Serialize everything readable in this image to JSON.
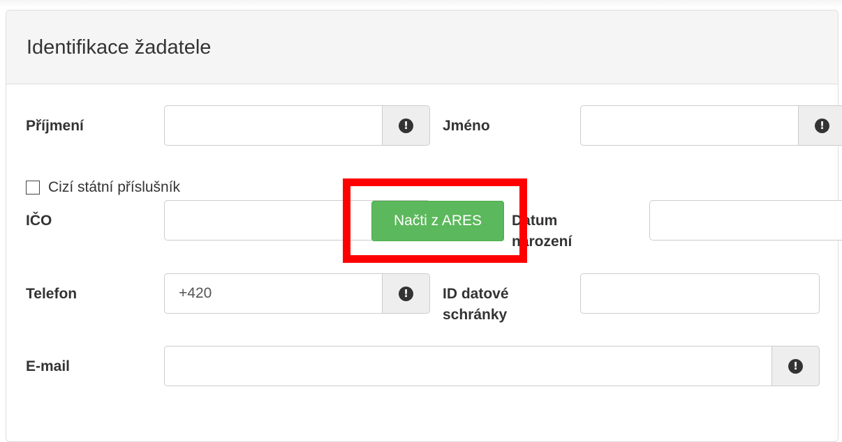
{
  "panel": {
    "title": "Identifikace žadatele"
  },
  "fields": {
    "prijmeni": {
      "label": "Příjmení",
      "value": "",
      "icon": "exclamation-circle-icon"
    },
    "jmeno": {
      "label": "Jméno",
      "value": "",
      "icon": "exclamation-circle-icon"
    },
    "cizi_statni": {
      "label": "Cizí státní příslušník",
      "checked": false
    },
    "ico": {
      "label": "IČO",
      "value": "",
      "icon": "exclamation-circle-icon"
    },
    "datum_narozeni": {
      "label_line1": "Datum",
      "label_line2": "narození",
      "value": ""
    },
    "telefon": {
      "label": "Telefon",
      "value": "+420",
      "icon": "exclamation-circle-icon"
    },
    "id_datove_schranky": {
      "label_line1": "ID datové",
      "label_line2": "schránky",
      "value": ""
    },
    "email": {
      "label": "E-mail",
      "value": "",
      "icon": "exclamation-circle-icon"
    }
  },
  "buttons": {
    "nacti_ares": {
      "label": "Načti z ARES"
    }
  },
  "icons": {
    "info_glyph": "!"
  },
  "colors": {
    "success_green": "#5cb85c",
    "highlight_red": "#ff0000",
    "panel_heading_bg": "#f5f5f5",
    "addon_bg": "#eeeeee"
  }
}
